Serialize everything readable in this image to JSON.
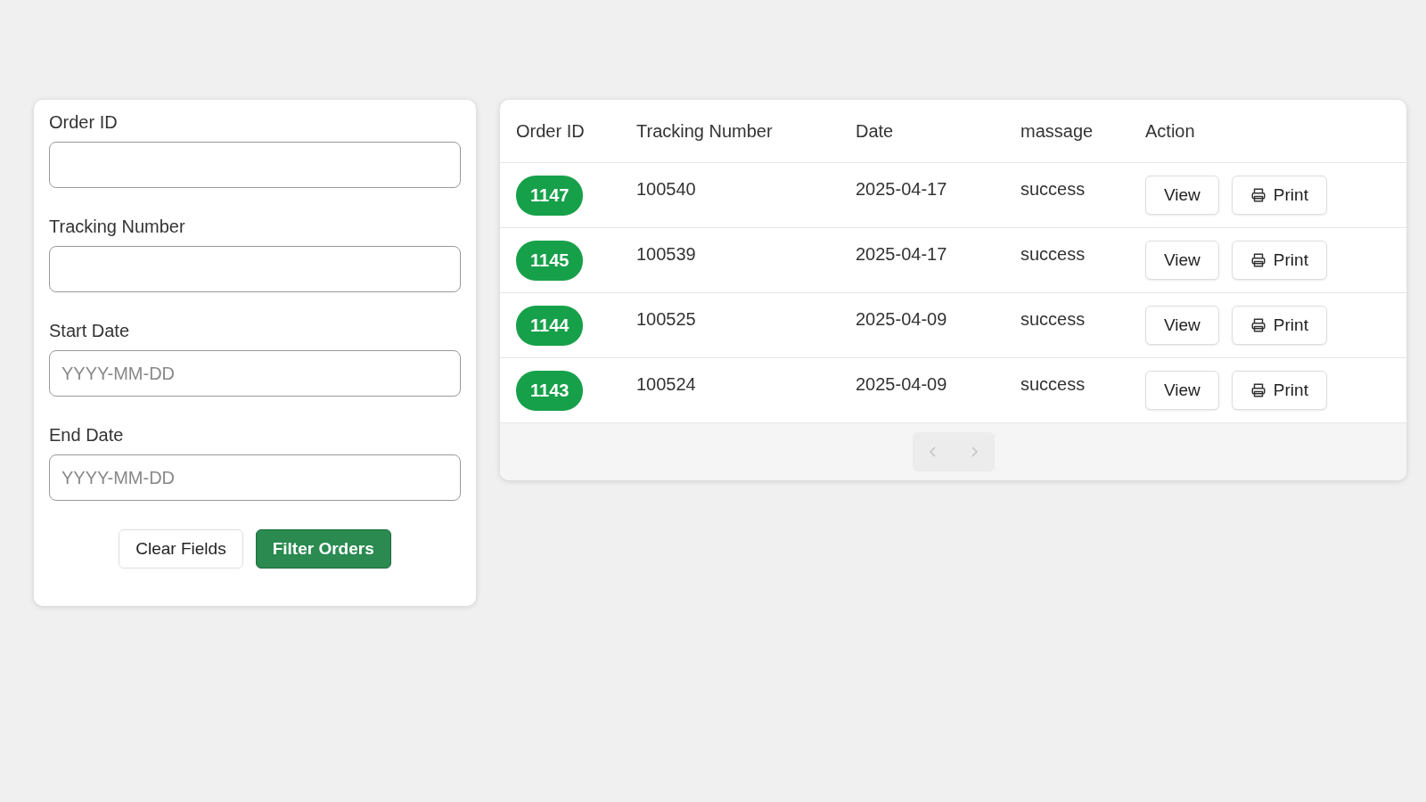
{
  "filters": [
    {
      "label": "Order ID"
    },
    {
      "label": "Tracking Number"
    },
    {
      "label": "Start Date",
      "placeholder": "YYYY-MM-DD"
    },
    {
      "label": "End Date",
      "placeholder": "YYYY-MM-DD"
    }
  ],
  "buttons": [
    {
      "label": "Clear Fields",
      "kind": "secondary"
    },
    {
      "label": "Filter Orders",
      "kind": "primary"
    }
  ],
  "table": {
    "columns": [
      "Order ID",
      "Tracking Number",
      "Date",
      "massage",
      "Action"
    ],
    "rows": [
      {
        "order_id": "1147",
        "tracking": "100540",
        "date": "2025-04-17",
        "message": "success",
        "actions": [
          "View",
          "Print"
        ]
      },
      {
        "order_id": "1145",
        "tracking": "100539",
        "date": "2025-04-17",
        "message": "success",
        "actions": [
          "View",
          "Print"
        ]
      },
      {
        "order_id": "1144",
        "tracking": "100525",
        "date": "2025-04-09",
        "message": "success",
        "actions": [
          "View",
          "Print"
        ]
      },
      {
        "order_id": "1143",
        "tracking": "100524",
        "date": "2025-04-09",
        "message": "success",
        "actions": [
          "View",
          "Print"
        ]
      }
    ]
  },
  "pagination": {
    "previous": {
      "disabled": true
    },
    "next": {
      "disabled": true
    }
  }
}
